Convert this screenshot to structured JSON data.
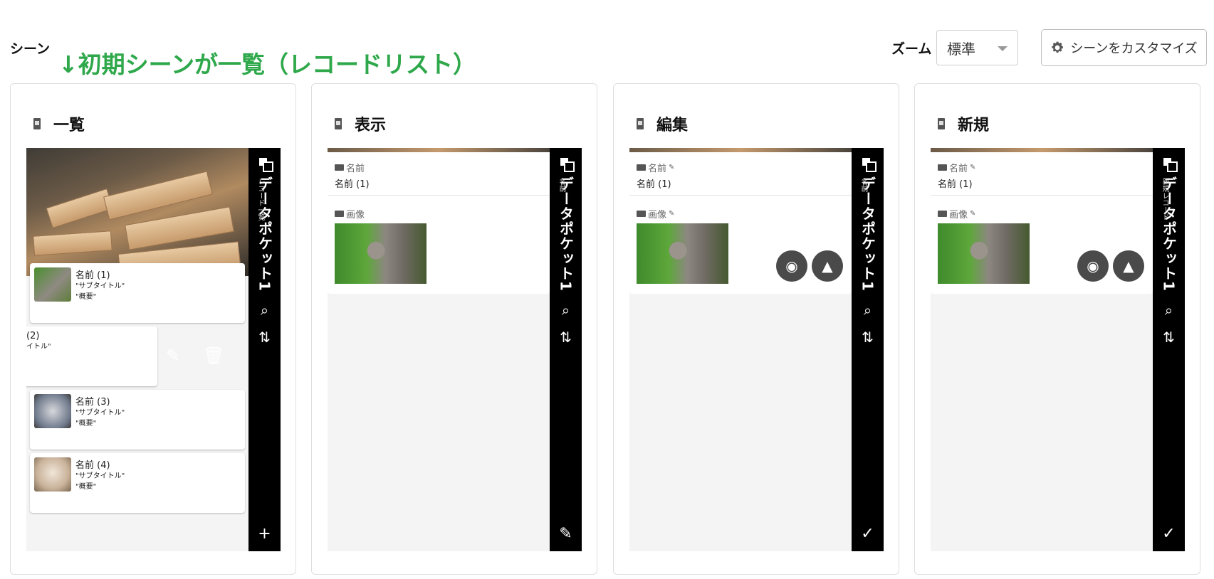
{
  "header": {
    "scene_label": "シーン",
    "annotation": "↓初期シーンが一覧（レコードリスト）",
    "zoom_label": "ズーム",
    "zoom_value": "標準",
    "customize_label": "シーンをカスタマイズ"
  },
  "app_title": "データポケット1",
  "cards": [
    {
      "title": "一覧",
      "subtitle": "レコード一覧",
      "items": [
        {
          "title": "名前 (1)",
          "sub1": "\"サブタイトル\"",
          "sub2": "\"概要\""
        },
        {
          "title": "(2)",
          "sub1": "イトル\"",
          "sub2": ""
        },
        {
          "title": "名前 (3)",
          "sub1": "\"サブタイトル\"",
          "sub2": "\"概要\""
        },
        {
          "title": "名前 (4)",
          "sub1": "\"サブタイトル\"",
          "sub2": "\"概要\""
        }
      ],
      "bottom_icon": "plus-icon"
    },
    {
      "title": "表示",
      "subtitle": "名前",
      "field_name_label": "名前",
      "field_name_value": "名前 (1)",
      "field_image_label": "画像",
      "bottom_icon": "edit-icon"
    },
    {
      "title": "編集",
      "subtitle": "名前",
      "field_name_label": "名前",
      "field_name_value": "名前 (1)",
      "field_image_label": "画像",
      "bottom_icon": "check-icon"
    },
    {
      "title": "新規",
      "subtitle": "新規レコード",
      "field_name_label": "名前",
      "field_name_value": "名前 (1)",
      "field_image_label": "画像",
      "bottom_icon": "check-icon"
    }
  ],
  "colors": {
    "annotation": "#2ea84a",
    "sidebar": "#000000",
    "round_button": "#4a4a4a"
  }
}
